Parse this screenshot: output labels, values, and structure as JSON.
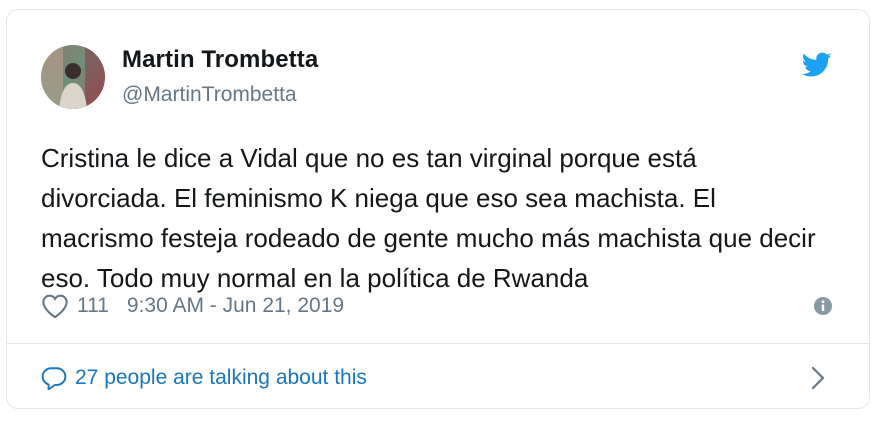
{
  "author": {
    "display_name": "Martin Trombetta",
    "handle": "@MartinTrombetta",
    "avatar_icon": "user-avatar"
  },
  "tweet": {
    "text": "Cristina le dice a Vidal que no es tan virginal porque está divorciada. El feminismo K niega que eso sea machista. El macrismo festeja rodeado de gente mucho más machista que decir eso. Todo muy normal en la política de Rwanda",
    "likes": "111",
    "timestamp": "9:30 AM - Jun 21, 2019"
  },
  "footer": {
    "talking_label": "27 people are talking about this"
  },
  "icons": {
    "brand": "twitter-bird-icon",
    "like": "heart-icon",
    "info": "info-icon",
    "conversation": "speech-bubble-icon",
    "chevron": "chevron-right-icon"
  },
  "colors": {
    "twitter_blue": "#1da1f2",
    "link_blue": "#1b76bd",
    "text_primary": "#14171a",
    "text_secondary": "#657786",
    "border": "#e1e8ed"
  }
}
